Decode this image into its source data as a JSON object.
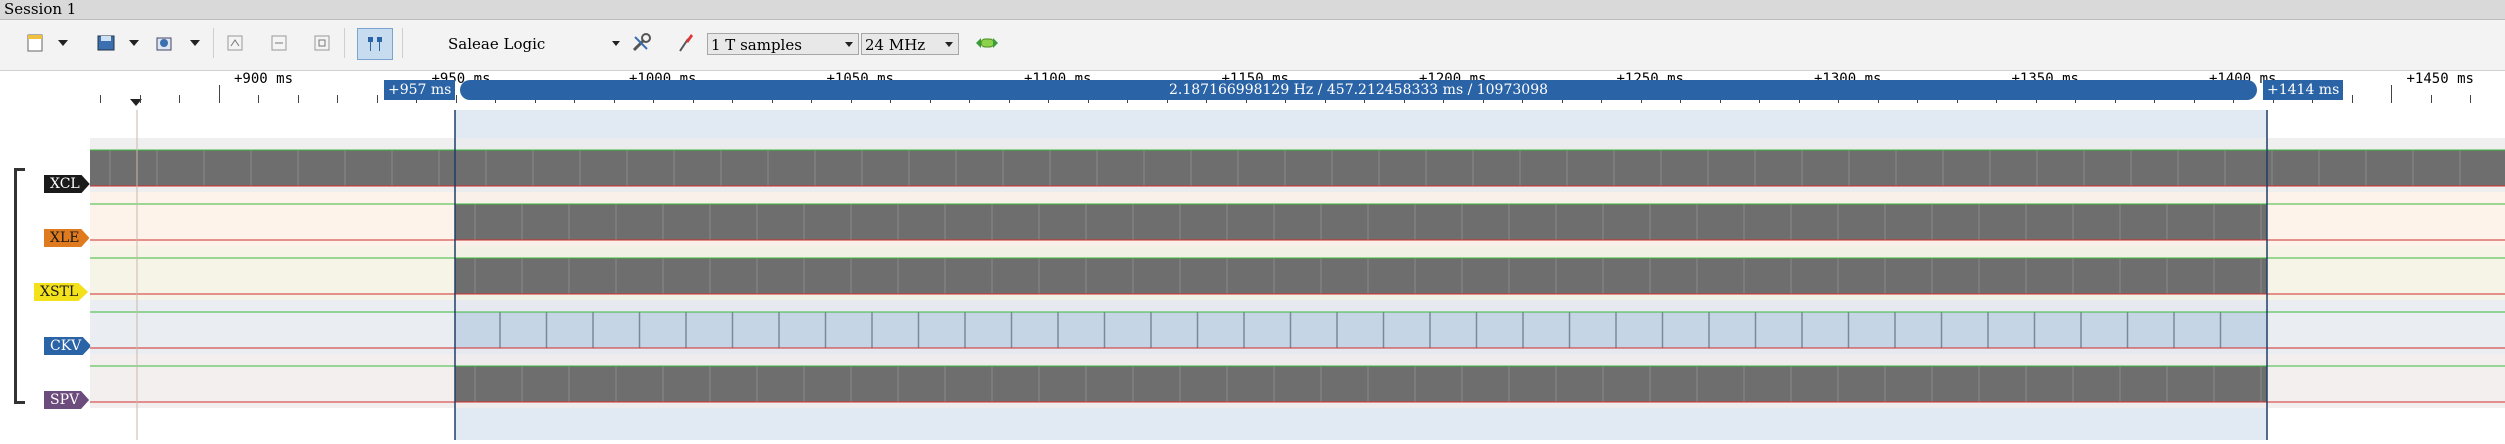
{
  "window": {
    "title": "Session 1"
  },
  "toolbar": {
    "device": "Saleae Logic",
    "samples": "1 T samples",
    "rate": "24 MHz"
  },
  "ruler": {
    "labels": [
      "+900 ms",
      "+950 ms",
      "+1000 ms",
      "+1050 ms",
      "+1100 ms",
      "+1150 ms",
      "+1200 ms",
      "+1250 ms",
      "+1300 ms",
      "+1350 ms",
      "+1400 ms",
      "+1450 ms"
    ]
  },
  "selection": {
    "start": "+957 ms",
    "end": "+1414 ms",
    "measurement": "2.187166998129 Hz / 457.212458333 ms / 10973098"
  },
  "channels": [
    {
      "name": "XCL",
      "color": "#1a1a1a",
      "text_color": "#ffffff",
      "lane_bg": "#ececec"
    },
    {
      "name": "XLE",
      "color": "#e07a1f",
      "text_color": "#1a1a1a",
      "lane_bg": "#fdf1e6"
    },
    {
      "name": "XSTL",
      "color": "#f3e11c",
      "text_color": "#1a1a1a",
      "lane_bg": "#f4f2e2"
    },
    {
      "name": "CKV",
      "color": "#2a63a6",
      "text_color": "#ffffff",
      "lane_bg": "#e6eaef"
    },
    {
      "name": "SPV",
      "color": "#6c4c7c",
      "text_color": "#ffffff",
      "lane_bg": "#f1ecec"
    }
  ],
  "colors": {
    "selection_fill": "#c9d9ea",
    "trace": "#6e6e6e",
    "high_line": "#3cb83c",
    "low_line": "#d02c2c"
  }
}
